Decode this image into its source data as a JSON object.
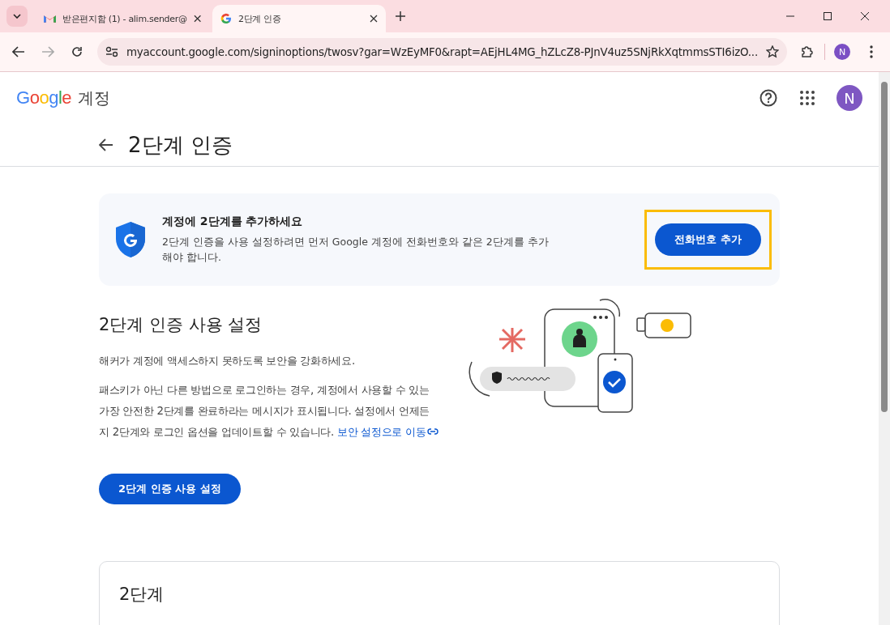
{
  "browser": {
    "tabs": [
      {
        "kind": "gmail",
        "title": "받은편지함 (1) - alim.sender@",
        "selected": false
      },
      {
        "kind": "google",
        "title": "2단계 인증",
        "selected": true
      }
    ],
    "url": "myaccount.google.com/signinoptions/twosv?gar=WzEyMF0&rapt=AEjHL4MG_hZLcZ8-PJnV4uz5SNjRkXqtmmsSTI6izO...",
    "profile_initial": "N"
  },
  "header": {
    "logo": "Google",
    "product": "계정",
    "avatar_initial": "N"
  },
  "page_title": "2단계 인증",
  "banner": {
    "title": "계정에 2단계를 추가하세요",
    "body": "2단계 인증을 사용 설정하려면 먼저 Google 계정에 전화번호와 같은 2단계를 추가해야 합니다.",
    "button": "전화번호 추가",
    "button_focused": true
  },
  "section": {
    "heading": "2단계 인증 사용 설정",
    "intro": "해커가 계정에 액세스하지 못하도록 보안을 강화하세요.",
    "paragraph": "패스키가 아닌 다른 방법으로 로그인하는 경우, 계정에서 사용할 수 있는 가장 안전한 2단계를 완료하라는 메시지가 표시됩니다. 설정에서 언제든지 2단계와 로그인 옵션을 업데이트할 수 있습니다.",
    "link": "보안 설정으로 이동",
    "button": "2단계 인증 사용 설정"
  },
  "card": {
    "heading": "2단계"
  }
}
